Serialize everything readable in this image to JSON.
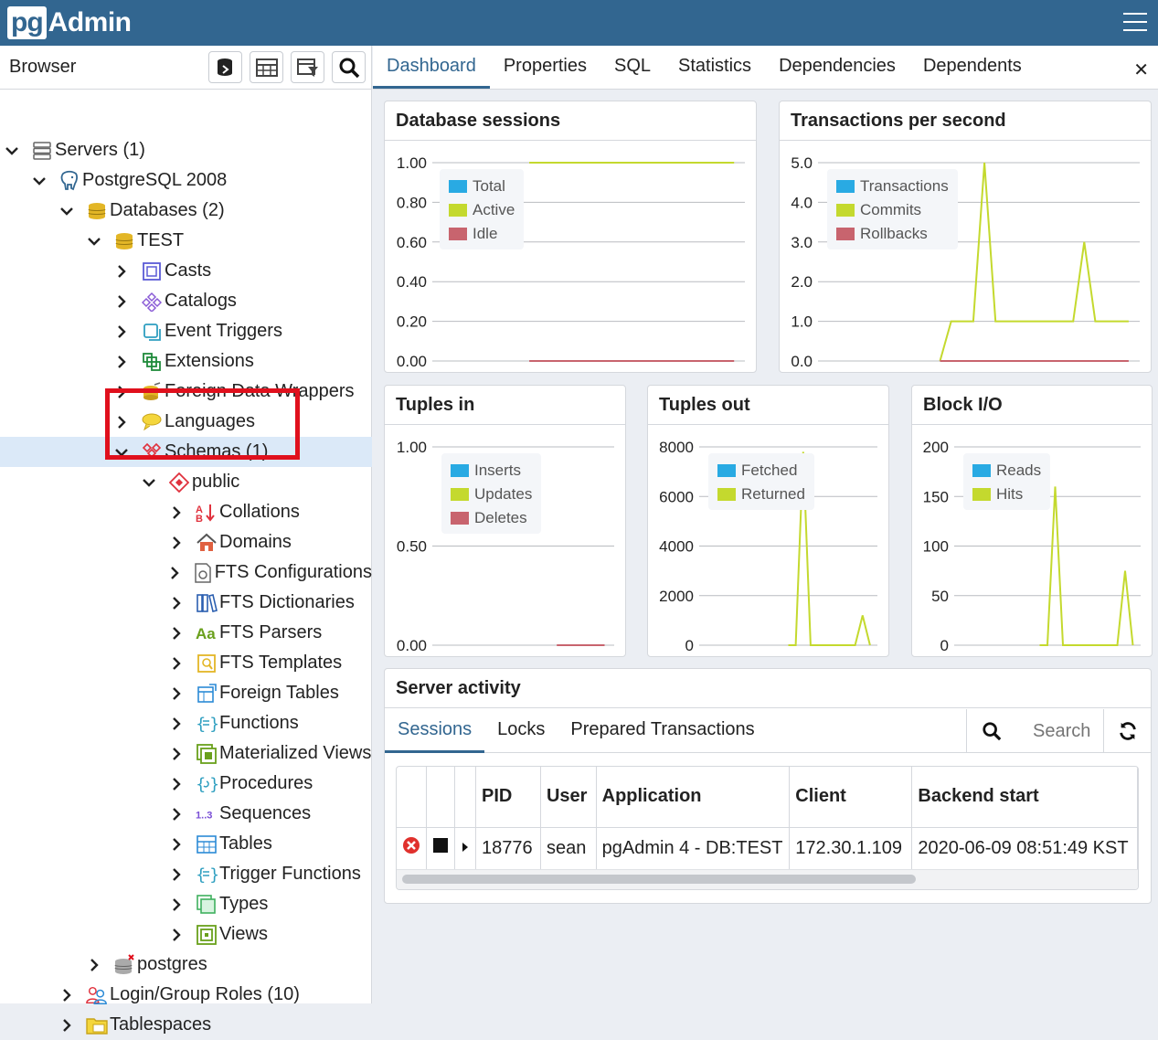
{
  "app": {
    "logo_pg": "pg",
    "logo_admin": "Admin"
  },
  "browser": {
    "title": "Browser",
    "toolbar": [
      "query-tool-icon",
      "view-data-icon",
      "filtered-rows-icon",
      "search-objects-icon"
    ]
  },
  "tree": [
    {
      "label": "Servers (1)",
      "indent": 0,
      "expanded": true,
      "icon": "servers-icon"
    },
    {
      "label": "PostgreSQL 2008",
      "indent": 1,
      "expanded": true,
      "icon": "postgres-elephant-icon"
    },
    {
      "label": "Databases (2)",
      "indent": 2,
      "expanded": true,
      "icon": "databases-icon"
    },
    {
      "label": "TEST",
      "indent": 3,
      "expanded": true,
      "icon": "database-icon"
    },
    {
      "label": "Casts",
      "indent": 4,
      "expanded": false,
      "icon": "casts-icon"
    },
    {
      "label": "Catalogs",
      "indent": 4,
      "expanded": false,
      "icon": "catalogs-icon"
    },
    {
      "label": "Event Triggers",
      "indent": 4,
      "expanded": false,
      "icon": "event-triggers-icon"
    },
    {
      "label": "Extensions",
      "indent": 4,
      "expanded": false,
      "icon": "extensions-icon"
    },
    {
      "label": "Foreign Data Wrappers",
      "indent": 4,
      "expanded": false,
      "icon": "foreign-data-wrappers-icon"
    },
    {
      "label": "Languages",
      "indent": 4,
      "expanded": false,
      "icon": "languages-icon"
    },
    {
      "label": "Schemas (1)",
      "indent": 4,
      "expanded": true,
      "icon": "schemas-icon",
      "selected": true
    },
    {
      "label": "public",
      "indent": 5,
      "expanded": true,
      "icon": "schema-icon"
    },
    {
      "label": "Collations",
      "indent": 6,
      "expanded": false,
      "icon": "collations-icon"
    },
    {
      "label": "Domains",
      "indent": 6,
      "expanded": false,
      "icon": "domains-icon"
    },
    {
      "label": "FTS Configurations",
      "indent": 6,
      "expanded": false,
      "icon": "fts-configurations-icon"
    },
    {
      "label": "FTS Dictionaries",
      "indent": 6,
      "expanded": false,
      "icon": "fts-dictionaries-icon"
    },
    {
      "label": "FTS Parsers",
      "indent": 6,
      "expanded": false,
      "icon": "fts-parsers-icon"
    },
    {
      "label": "FTS Templates",
      "indent": 6,
      "expanded": false,
      "icon": "fts-templates-icon"
    },
    {
      "label": "Foreign Tables",
      "indent": 6,
      "expanded": false,
      "icon": "foreign-tables-icon"
    },
    {
      "label": "Functions",
      "indent": 6,
      "expanded": false,
      "icon": "functions-icon"
    },
    {
      "label": "Materialized Views",
      "indent": 6,
      "expanded": false,
      "icon": "materialized-views-icon"
    },
    {
      "label": "Procedures",
      "indent": 6,
      "expanded": false,
      "icon": "procedures-icon"
    },
    {
      "label": "Sequences",
      "indent": 6,
      "expanded": false,
      "icon": "sequences-icon"
    },
    {
      "label": "Tables",
      "indent": 6,
      "expanded": false,
      "icon": "tables-icon"
    },
    {
      "label": "Trigger Functions",
      "indent": 6,
      "expanded": false,
      "icon": "trigger-functions-icon"
    },
    {
      "label": "Types",
      "indent": 6,
      "expanded": false,
      "icon": "types-icon"
    },
    {
      "label": "Views",
      "indent": 6,
      "expanded": false,
      "icon": "views-icon"
    },
    {
      "label": "postgres",
      "indent": 3,
      "expanded": false,
      "icon": "database-disconnected-icon"
    },
    {
      "label": "Login/Group Roles (10)",
      "indent": 2,
      "expanded": false,
      "icon": "roles-icon"
    },
    {
      "label": "Tablespaces",
      "indent": 2,
      "expanded": false,
      "icon": "tablespaces-icon"
    }
  ],
  "tabs": [
    "Dashboard",
    "Properties",
    "SQL",
    "Statistics",
    "Dependencies",
    "Dependents"
  ],
  "active_tab": "Dashboard",
  "colors": {
    "blue": "#29aae3",
    "green": "#c4d92e",
    "red": "#c8646e",
    "accent": "#326690"
  },
  "chart_data": [
    {
      "type": "line",
      "title": "Database sessions",
      "yticks": [
        "1.00",
        "0.80",
        "0.60",
        "0.40",
        "0.20",
        "0.00"
      ],
      "ylim": [
        0,
        1
      ],
      "series": [
        {
          "name": "Total",
          "color": "#29aae3"
        },
        {
          "name": "Active",
          "color": "#c4d92e",
          "values": [
            1,
            1,
            1,
            1,
            1,
            1,
            1,
            1,
            1,
            1,
            1,
            1,
            1,
            1,
            1,
            1,
            1,
            1,
            1,
            1
          ],
          "start_index": 9
        },
        {
          "name": "Idle",
          "color": "#c8646e",
          "values": [
            0,
            0,
            0,
            0,
            0,
            0,
            0,
            0,
            0,
            0,
            0,
            0,
            0,
            0,
            0,
            0,
            0,
            0,
            0,
            0
          ],
          "start_index": 9
        }
      ]
    },
    {
      "type": "line",
      "title": "Transactions per second",
      "yticks": [
        "5.0",
        "4.0",
        "3.0",
        "2.0",
        "1.0",
        "0.0"
      ],
      "ylim": [
        0,
        5
      ],
      "series": [
        {
          "name": "Transactions",
          "color": "#29aae3"
        },
        {
          "name": "Commits",
          "color": "#c4d92e",
          "values": [
            0,
            1,
            1,
            1,
            5,
            1,
            1,
            1,
            1,
            1,
            1,
            1,
            1,
            3,
            1,
            1,
            1,
            1
          ],
          "start_index": 11
        },
        {
          "name": "Rollbacks",
          "color": "#c8646e",
          "values": [
            0,
            0,
            0,
            0,
            0,
            0,
            0,
            0,
            0,
            0,
            0,
            0,
            0,
            0,
            0,
            0,
            0,
            0
          ],
          "start_index": 11
        }
      ]
    },
    {
      "type": "line",
      "title": "Tuples in",
      "yticks": [
        "1.00",
        "0.50",
        "0.00"
      ],
      "ylim": [
        0,
        1
      ],
      "series": [
        {
          "name": "Inserts",
          "color": "#29aae3"
        },
        {
          "name": "Updates",
          "color": "#c4d92e"
        },
        {
          "name": "Deletes",
          "color": "#c8646e",
          "values": [
            0,
            0,
            0,
            0,
            0,
            0
          ],
          "start_index": 13
        }
      ]
    },
    {
      "type": "line",
      "title": "Tuples out",
      "yticks": [
        "8000",
        "6000",
        "4000",
        "2000",
        "0"
      ],
      "ylim": [
        0,
        8000
      ],
      "series": [
        {
          "name": "Fetched",
          "color": "#29aae3"
        },
        {
          "name": "Returned",
          "color": "#c4d92e",
          "values": [
            0,
            0,
            7800,
            0,
            0,
            0,
            0,
            0,
            0,
            0,
            1200,
            0
          ],
          "start_index": 12
        }
      ]
    },
    {
      "type": "line",
      "title": "Block I/O",
      "yticks": [
        "200",
        "150",
        "100",
        "50",
        "0"
      ],
      "ylim": [
        0,
        200
      ],
      "series": [
        {
          "name": "Reads",
          "color": "#29aae3"
        },
        {
          "name": "Hits",
          "color": "#c4d92e",
          "values": [
            0,
            0,
            160,
            0,
            0,
            0,
            0,
            0,
            0,
            0,
            0,
            75,
            0
          ],
          "start_index": 11
        }
      ]
    }
  ],
  "server_activity": {
    "title": "Server activity",
    "tabs": [
      "Sessions",
      "Locks",
      "Prepared Transactions"
    ],
    "search_placeholder": "Search",
    "columns": [
      "PID",
      "User",
      "Application",
      "Client",
      "Backend start"
    ],
    "rows": [
      {
        "pid": "18776",
        "user": "sean",
        "application": "pgAdmin 4 - DB:TEST",
        "client": "172.30.1.109",
        "backend_start": "2020-06-09 08:51:49 KST"
      }
    ]
  }
}
